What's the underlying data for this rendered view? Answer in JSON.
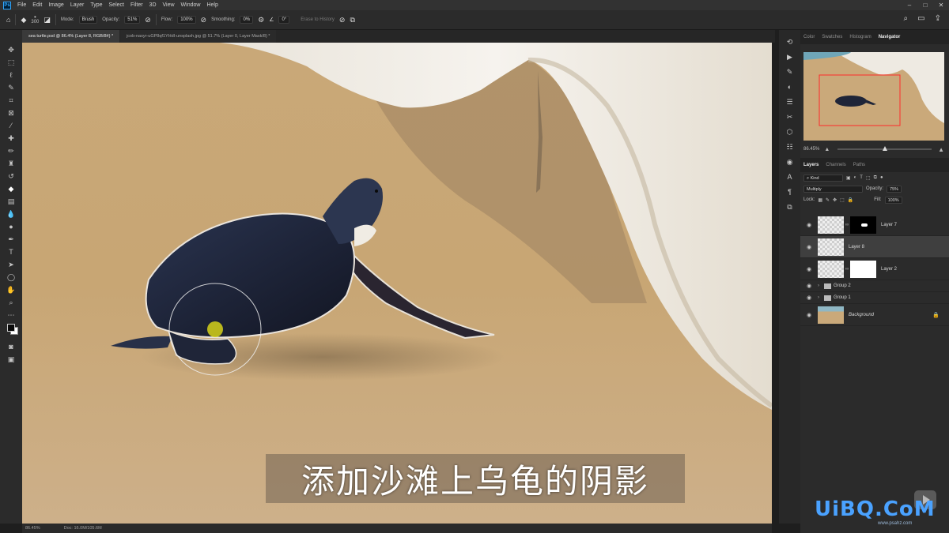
{
  "app": {
    "logo": "Ps"
  },
  "menu": [
    "File",
    "Edit",
    "Image",
    "Layer",
    "Type",
    "Select",
    "Filter",
    "3D",
    "View",
    "Window",
    "Help"
  ],
  "options": {
    "brush_size": "300",
    "mode_label": "Mode:",
    "mode_value": "Brush",
    "opacity_label": "Opacity:",
    "opacity_value": "51%",
    "flow_label": "Flow:",
    "flow_value": "100%",
    "smoothing_label": "Smoothing:",
    "smoothing_value": "0%",
    "angle_value": "0°",
    "erase_history": "Erase to History"
  },
  "tabs": [
    {
      "label": "sea turtle.psd @ 86.4% (Layer 8, RGB/8#) *",
      "active": true
    },
    {
      "label": "jcob-nasyr-uGP8qf1YHdI-unsplash.jpg @ 51.7% (Layer 0, Layer Mask/8) *",
      "active": false
    }
  ],
  "subtitle": "添加沙滩上乌龟的阴影",
  "status": {
    "zoom": "86.45%",
    "doc": "Doc: 16.0M/105.6M"
  },
  "panels": {
    "top_tabs": [
      "Color",
      "Swatches",
      "Histogram",
      "Navigator"
    ],
    "active_top_tab": "Navigator",
    "nav_zoom": "86.45%",
    "layer_tabs": [
      "Layers",
      "Channels",
      "Paths"
    ],
    "filter_kind": "Kind",
    "blend_mode": "Multiply",
    "opacity_label": "Opacity:",
    "opacity_value": "75%",
    "lock_label": "Lock:",
    "fill_label": "Fill:",
    "fill_value": "100%"
  },
  "layers": [
    {
      "name": "Layer 7",
      "type": "masked",
      "selected": false
    },
    {
      "name": "Layer 8",
      "type": "plain",
      "selected": true
    },
    {
      "name": "Layer 2",
      "type": "masked",
      "selected": false
    },
    {
      "name": "Group 2",
      "type": "group",
      "selected": false
    },
    {
      "name": "Group 1",
      "type": "group",
      "selected": false
    },
    {
      "name": "Background",
      "type": "background",
      "selected": false
    }
  ],
  "watermark": {
    "text": "UiBQ.CoM",
    "sub": "www.psahz.com"
  },
  "colors": {
    "accent": "#31a8ff",
    "sand": "#caa97a",
    "foam": "#f2efe8",
    "turtle": "#1c2236"
  }
}
